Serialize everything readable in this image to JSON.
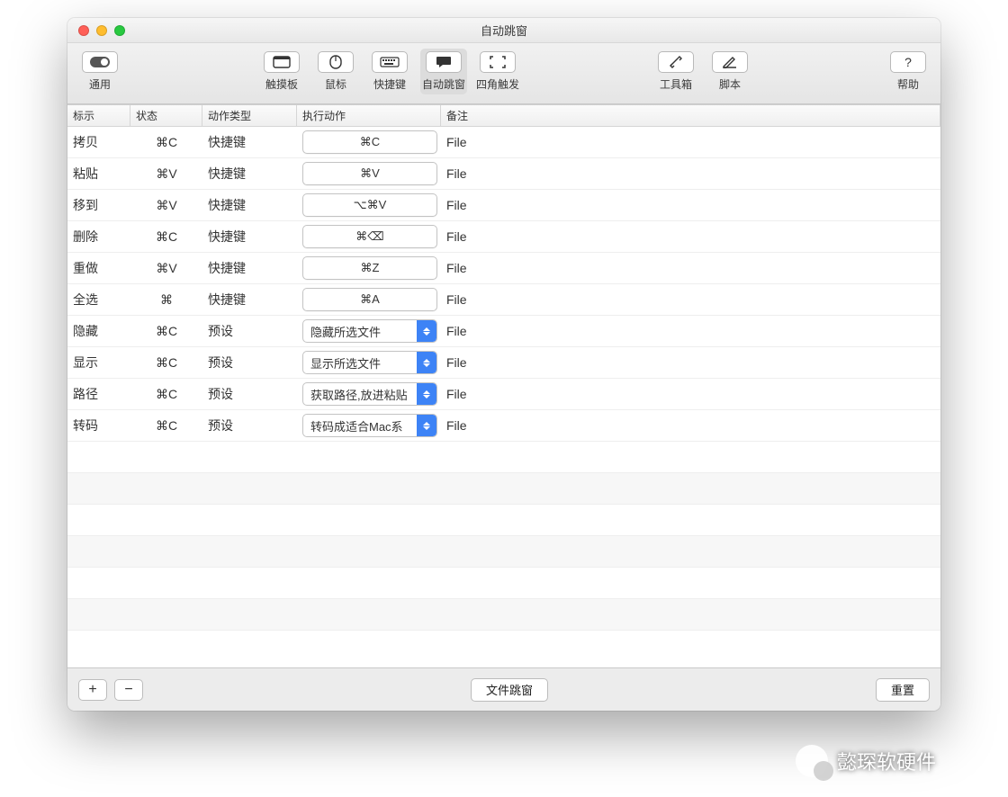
{
  "window": {
    "title": "自动跳窗"
  },
  "toolbar": {
    "general": "通用",
    "trackpad": "触摸板",
    "mouse": "鼠标",
    "shortcut": "快捷键",
    "autopopup": "自动跳窗",
    "corner": "四角触发",
    "toolbox": "工具箱",
    "script": "脚本",
    "help": "帮助"
  },
  "columns": {
    "label": "标示",
    "status": "状态",
    "type": "动作类型",
    "action": "执行动作",
    "remark": "备注"
  },
  "rows": [
    {
      "label": "拷贝",
      "status": "⌘C",
      "type": "快捷键",
      "action": "⌘C",
      "kind": "btn",
      "remark": "File"
    },
    {
      "label": "粘贴",
      "status": "⌘V",
      "type": "快捷键",
      "action": "⌘V",
      "kind": "btn",
      "remark": "File"
    },
    {
      "label": "移到",
      "status": "⌘V",
      "type": "快捷键",
      "action": "⌥⌘V",
      "kind": "btn",
      "remark": "File"
    },
    {
      "label": "删除",
      "status": "⌘C",
      "type": "快捷键",
      "action": "⌘⌫",
      "kind": "btn",
      "remark": "File"
    },
    {
      "label": "重做",
      "status": "⌘V",
      "type": "快捷键",
      "action": "⌘Z",
      "kind": "btn",
      "remark": "File"
    },
    {
      "label": "全选",
      "status": "⌘",
      "type": "快捷键",
      "action": "⌘A",
      "kind": "btn",
      "remark": "File"
    },
    {
      "label": "隐藏",
      "status": "⌘C",
      "type": "预设",
      "action": "隐藏所选文件",
      "kind": "select",
      "remark": "File"
    },
    {
      "label": "显示",
      "status": "⌘C",
      "type": "预设",
      "action": "显示所选文件",
      "kind": "select",
      "remark": "File"
    },
    {
      "label": "路径",
      "status": "⌘C",
      "type": "预设",
      "action": "获取路径,放进粘贴",
      "kind": "select",
      "remark": "File"
    },
    {
      "label": "转码",
      "status": "⌘C",
      "type": "预设",
      "action": "转码成适合Mac系",
      "kind": "select",
      "remark": "File"
    }
  ],
  "footer": {
    "add": "+",
    "remove": "−",
    "center": "文件跳窗",
    "reset": "重置"
  },
  "watermark": "㦤琛软硬件"
}
